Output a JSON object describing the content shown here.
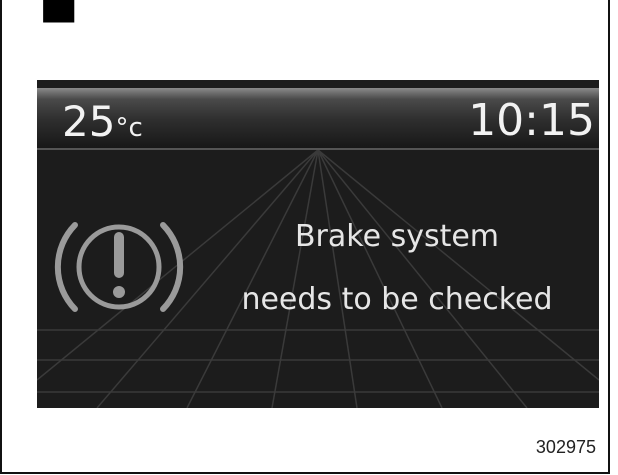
{
  "display": {
    "temperature": {
      "value": "25",
      "unit": "°c"
    },
    "clock": "10:15",
    "warning": {
      "icon": "brake-system-warning-icon",
      "message_line1": "Brake system",
      "message_line2": "needs to be checked"
    }
  },
  "figure_number": "302975",
  "colors": {
    "display_background": "#1c1c1c",
    "text": "#f2f2f2",
    "icon": "#9a9a9a"
  }
}
